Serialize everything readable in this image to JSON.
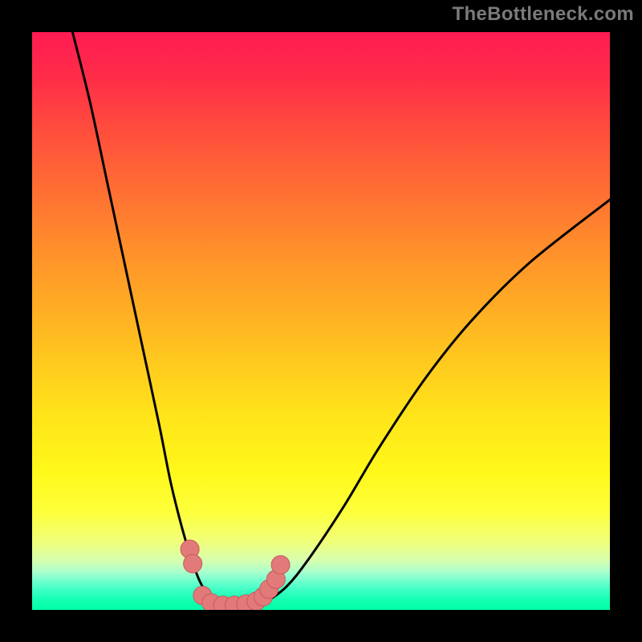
{
  "watermark": "TheBottleneck.com",
  "colors": {
    "frame": "#000000",
    "curve": "#000000",
    "dot_fill": "#e27a7a",
    "dot_stroke": "#c85a5a"
  },
  "chart_data": {
    "type": "line",
    "title": "",
    "xlabel": "",
    "ylabel": "",
    "xlim": [
      0,
      100
    ],
    "ylim": [
      0,
      100
    ],
    "grid": false,
    "legend": false,
    "note": "Bottleneck-style V curve. No axis ticks or numeric labels are rendered in the source image; y-values below are visual estimates of curve height as percent of plot area, x is percent across width.",
    "series": [
      {
        "name": "left-branch",
        "x": [
          7,
          10,
          13,
          16,
          19,
          22,
          24,
          26,
          27.5,
          29,
          30.5,
          32
        ],
        "y": [
          100,
          88,
          74,
          60,
          46,
          32,
          22,
          14,
          9,
          5,
          2.5,
          1
        ]
      },
      {
        "name": "floor",
        "x": [
          32,
          34,
          36,
          38,
          40
        ],
        "y": [
          1,
          0.5,
          0.5,
          0.6,
          1
        ]
      },
      {
        "name": "right-branch",
        "x": [
          40,
          44,
          48,
          54,
          60,
          68,
          76,
          86,
          100
        ],
        "y": [
          1,
          4,
          9,
          18,
          28,
          40,
          50,
          60,
          71
        ]
      }
    ],
    "markers": {
      "name": "highlight-dots",
      "note": "Salmon dots clustered near the curve minimum; coordinates in same percent space.",
      "points": [
        {
          "x": 27.3,
          "y": 10.5
        },
        {
          "x": 27.8,
          "y": 8.0
        },
        {
          "x": 29.5,
          "y": 2.5
        },
        {
          "x": 31.0,
          "y": 1.2
        },
        {
          "x": 33.0,
          "y": 0.8
        },
        {
          "x": 35.0,
          "y": 0.8
        },
        {
          "x": 37.0,
          "y": 1.0
        },
        {
          "x": 38.8,
          "y": 1.5
        },
        {
          "x": 40.0,
          "y": 2.3
        },
        {
          "x": 41.0,
          "y": 3.6
        },
        {
          "x": 42.2,
          "y": 5.3
        },
        {
          "x": 43.0,
          "y": 7.8
        }
      ],
      "radius_pct": 1.6
    }
  }
}
